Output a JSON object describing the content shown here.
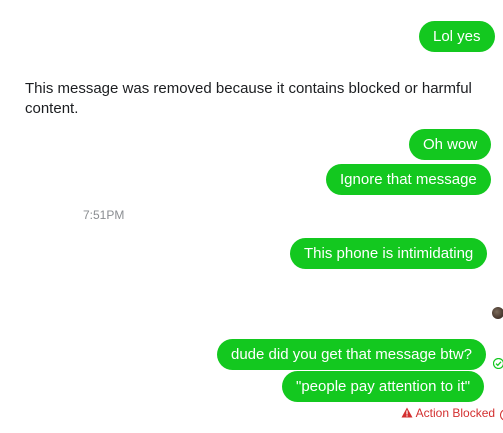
{
  "messages": {
    "m1": "Lol yes",
    "removed_notice": "This message was removed because it contains blocked or harmful content.",
    "m2": "Oh wow",
    "m3": "Ignore that message",
    "timestamp": "7:51PM",
    "m4": "This phone is intimidating",
    "m5": "dude did you get that message btw?",
    "m6": "\"people pay attention to it\""
  },
  "status": {
    "blocked_label": "Action Blocked"
  },
  "colors": {
    "bubble": "#13c81f",
    "blocked": "#d32f2f"
  }
}
